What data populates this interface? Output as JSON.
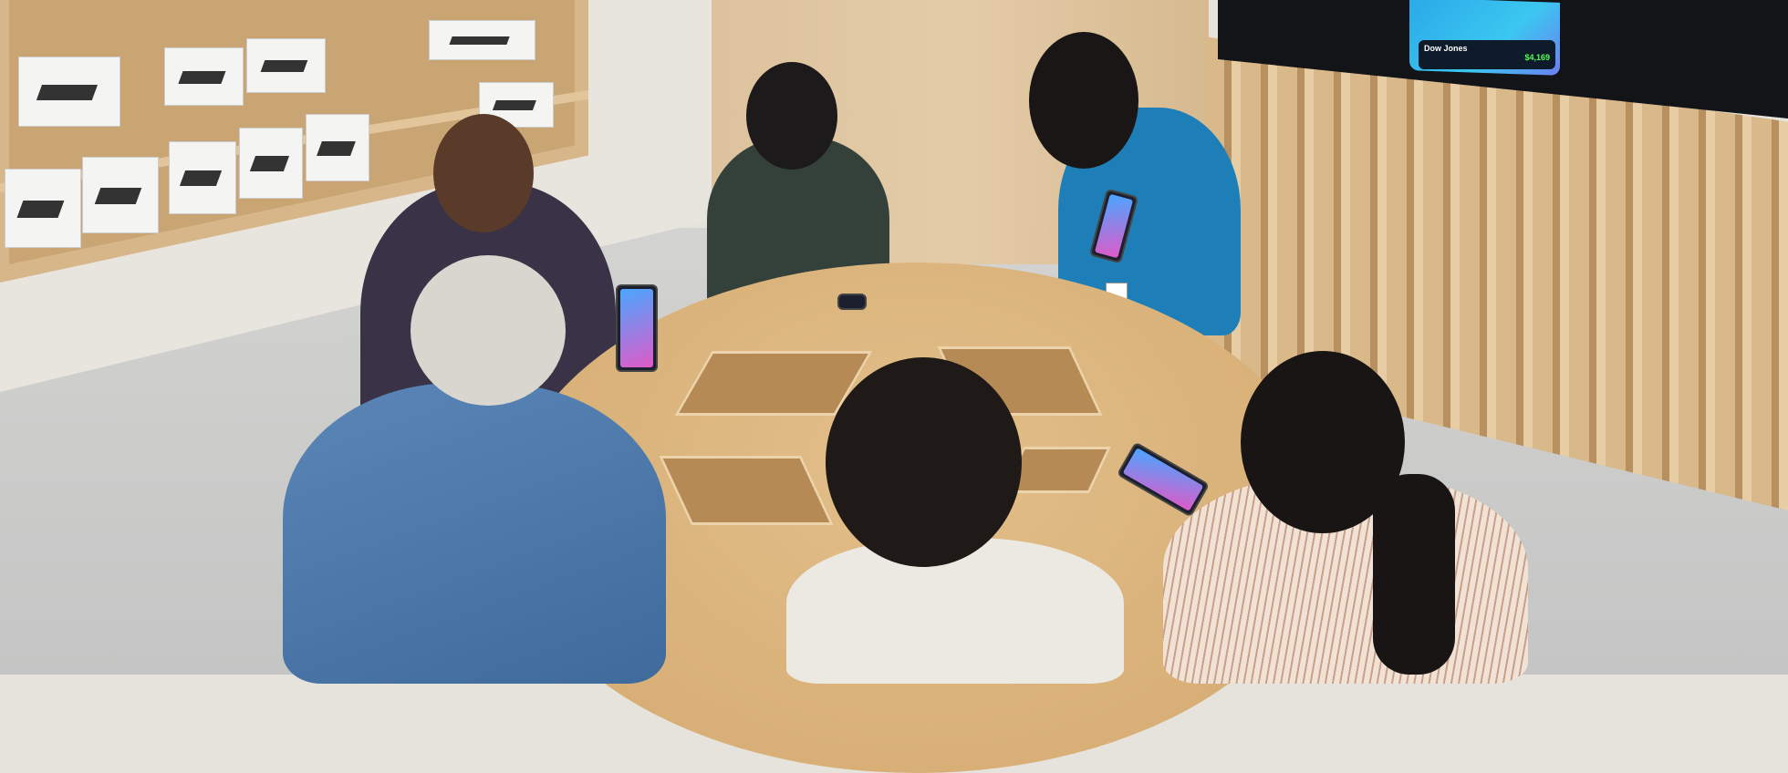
{
  "scene": {
    "tv_screen": {
      "widget_title": "Dow Jones",
      "widget_value": "$4,169"
    }
  },
  "colors": {
    "table": "#d8b27a",
    "wall_wood": "#dcc29d",
    "tv": "#121418",
    "floor": "#cacbca"
  }
}
